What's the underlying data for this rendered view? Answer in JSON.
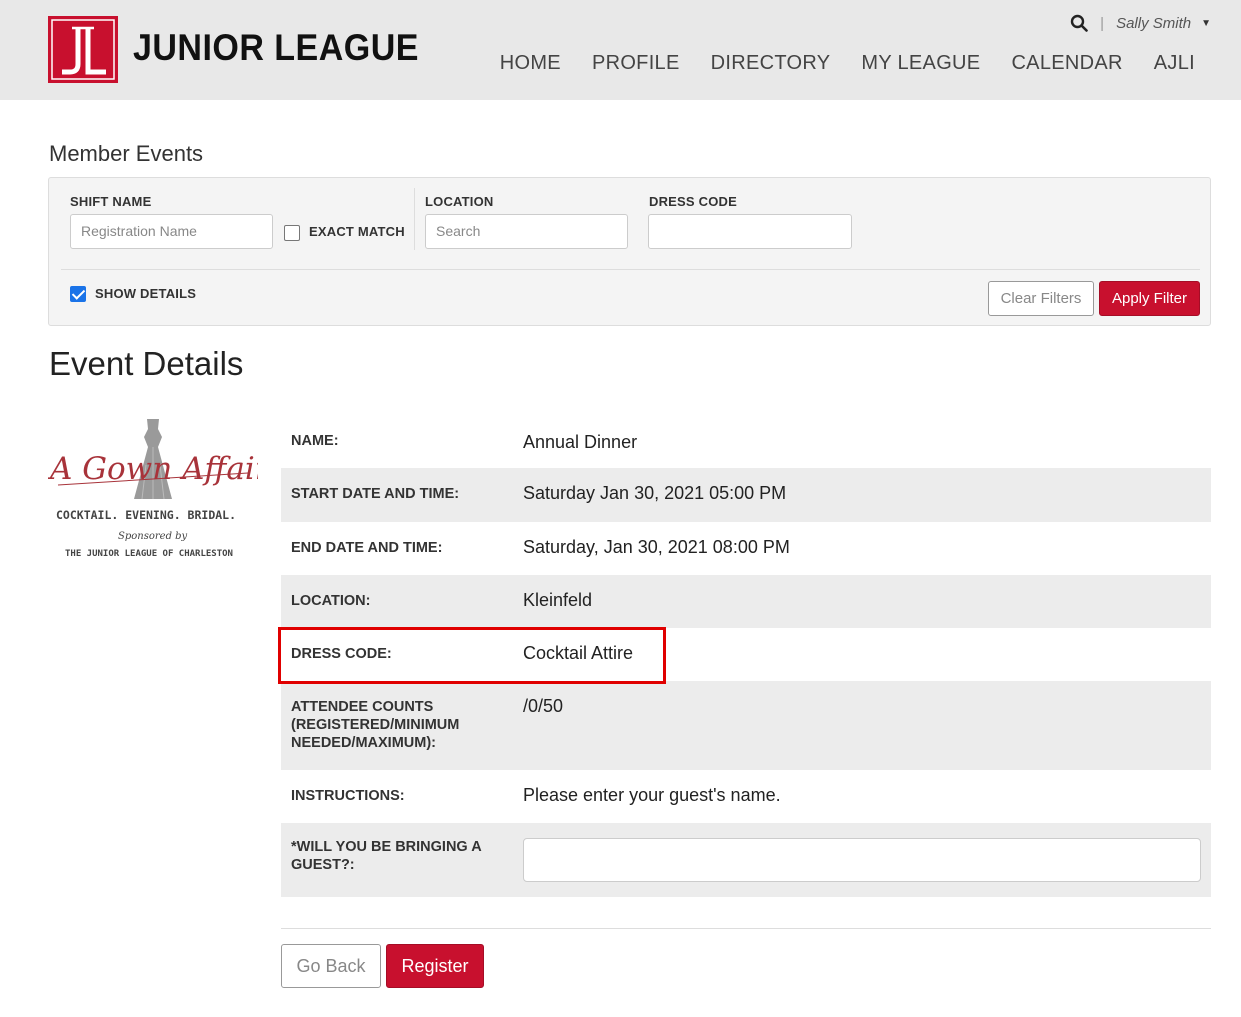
{
  "header": {
    "brand": "JUNIOR LEAGUE",
    "user": "Sally Smith",
    "nav": [
      "HOME",
      "PROFILE",
      "DIRECTORY",
      "MY LEAGUE",
      "CALENDAR",
      "AJLI"
    ]
  },
  "filters": {
    "title": "Member Events",
    "shift_name_label": "SHIFT NAME",
    "shift_name_placeholder": "Registration Name",
    "exact_match_label": "EXACT MATCH",
    "location_label": "LOCATION",
    "location_placeholder": "Search",
    "dress_code_label": "DRESS CODE",
    "dress_code_value": "",
    "show_details_label": "SHOW DETAILS",
    "show_details_checked": true,
    "clear_label": "Clear Filters",
    "apply_label": "Apply Filter"
  },
  "event": {
    "title": "Event Details",
    "logo_text": {
      "script": "A Gown Affair",
      "tagline": "COCKTAIL. EVENING. BRIDAL.",
      "sponsored": "Sponsored by",
      "league": "THE JUNIOR LEAGUE OF CHARLESTON"
    },
    "rows": [
      {
        "label": "NAME:",
        "value": "Annual Dinner"
      },
      {
        "label": "START DATE AND TIME:",
        "value": "Saturday Jan 30, 2021 05:00 PM"
      },
      {
        "label": "END DATE AND TIME:",
        "value": "Saturday, Jan 30, 2021 08:00 PM"
      },
      {
        "label": "LOCATION:",
        "value": "Kleinfeld"
      },
      {
        "label": "DRESS CODE:",
        "value": "Cocktail Attire"
      },
      {
        "label": "ATTENDEE COUNTS (REGISTERED/MINIMUM NEEDED/MAXIMUM):",
        "value": "/0/50"
      },
      {
        "label": "INSTRUCTIONS:",
        "value": "Please enter your guest's name."
      },
      {
        "label": "*WILL YOU BE BRINGING A GUEST?:",
        "value": ""
      }
    ],
    "back_label": "Go Back",
    "register_label": "Register"
  },
  "colors": {
    "brand_red": "#c8102e",
    "highlight": "#e00000",
    "checkbox_blue": "#1a73e8"
  }
}
